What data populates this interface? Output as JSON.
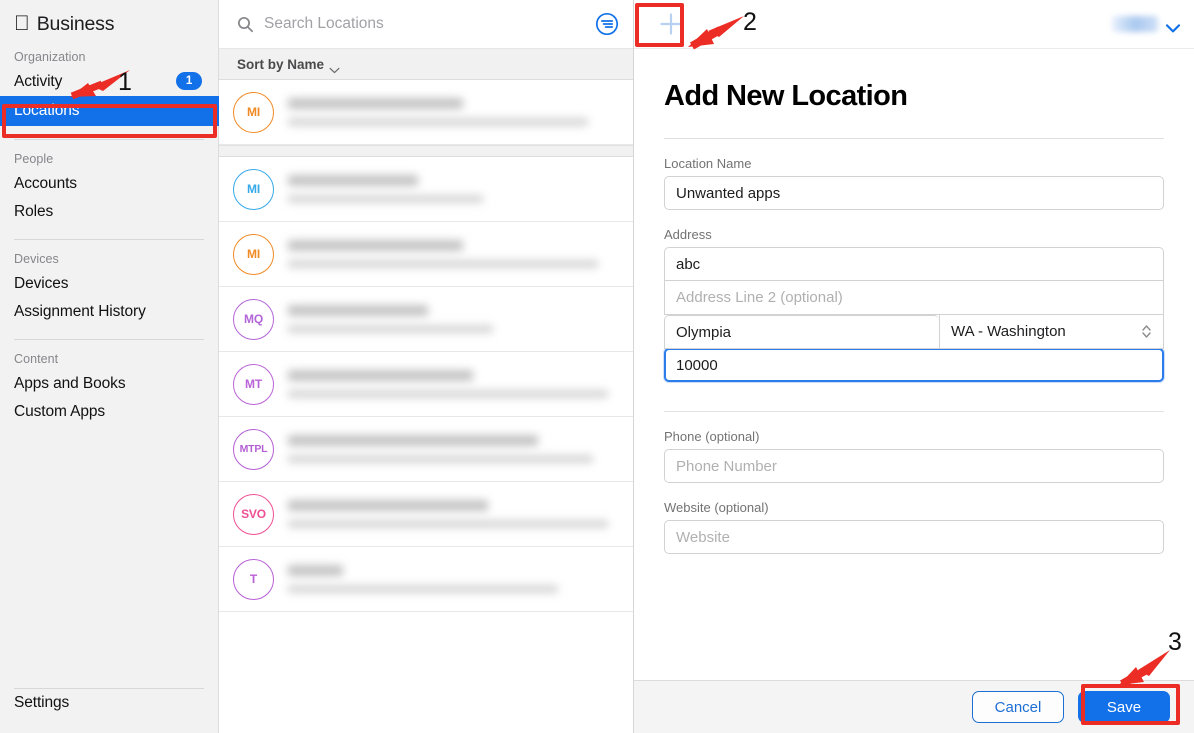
{
  "sidebar": {
    "brand": "Business",
    "apple_glyph": "",
    "groups": [
      {
        "label": "Organization",
        "items": [
          {
            "name": "Activity",
            "badge": "1",
            "selected": false
          },
          {
            "name": "Locations",
            "badge": null,
            "selected": true
          }
        ]
      },
      {
        "label": "People",
        "items": [
          {
            "name": "Accounts",
            "badge": null,
            "selected": false
          },
          {
            "name": "Roles",
            "badge": null,
            "selected": false
          }
        ]
      },
      {
        "label": "Devices",
        "items": [
          {
            "name": "Devices",
            "badge": null,
            "selected": false
          },
          {
            "name": "Assignment History",
            "badge": null,
            "selected": false
          }
        ]
      },
      {
        "label": "Content",
        "items": [
          {
            "name": "Apps and Books",
            "badge": null,
            "selected": false
          },
          {
            "name": "Custom Apps",
            "badge": null,
            "selected": false
          }
        ]
      }
    ],
    "settings": "Settings"
  },
  "list": {
    "search_placeholder": "Search Locations",
    "search_value": "",
    "filter_icon": "filter-icon",
    "sort_label": "Sort by Name",
    "add_icon": "plus-icon",
    "rows": [
      {
        "initials": "MI",
        "color": "#f08a24",
        "title_w": 175,
        "sub_w": 300,
        "separator_after": true
      },
      {
        "initials": "MI",
        "color": "#36a9e8",
        "title_w": 130,
        "sub_w": 195,
        "separator_after": false
      },
      {
        "initials": "MI",
        "color": "#f08a24",
        "title_w": 175,
        "sub_w": 310,
        "separator_after": false
      },
      {
        "initials": "MQ",
        "color": "#b265d8",
        "title_w": 140,
        "sub_w": 205,
        "separator_after": false
      },
      {
        "initials": "MT",
        "color": "#bb63d6",
        "title_w": 185,
        "sub_w": 320,
        "separator_after": false
      },
      {
        "initials": "MTPL",
        "color": "#b35fd4",
        "title_w": 250,
        "sub_w": 305,
        "separator_after": false
      },
      {
        "initials": "SVO",
        "color": "#ee4f94",
        "title_w": 200,
        "sub_w": 320,
        "separator_after": false
      },
      {
        "initials": "T",
        "color": "#b85fd6",
        "title_w": 55,
        "sub_w": 270,
        "separator_after": false
      }
    ]
  },
  "account": {
    "chevron_icon": "chevron-down-icon"
  },
  "panel": {
    "title": "Add New Location",
    "fields": {
      "location_name_label": "Location Name",
      "location_name_value": "Unwanted apps",
      "address_label": "Address",
      "address_value": "abc",
      "address2_placeholder": "Address Line 2 (optional)",
      "address2_value": "",
      "city_value": "Olympia",
      "state_value": "WA - Washington",
      "zip_value": "10000",
      "phone_label": "Phone (optional)",
      "phone_placeholder": "Phone Number",
      "phone_value": "",
      "website_label": "Website (optional)",
      "website_placeholder": "Website",
      "website_value": ""
    },
    "footer": {
      "cancel_label": "Cancel",
      "save_label": "Save"
    }
  },
  "annotations": {
    "marker_1": "1",
    "marker_2": "2",
    "marker_3": "3",
    "highlight_color": "#ec2d26"
  },
  "colors": {
    "accent_blue": "#1271e8",
    "selected_bg": "#1271e8",
    "sidebar_bg": "#f2f2f2",
    "annotation_red": "#ec2d26"
  }
}
